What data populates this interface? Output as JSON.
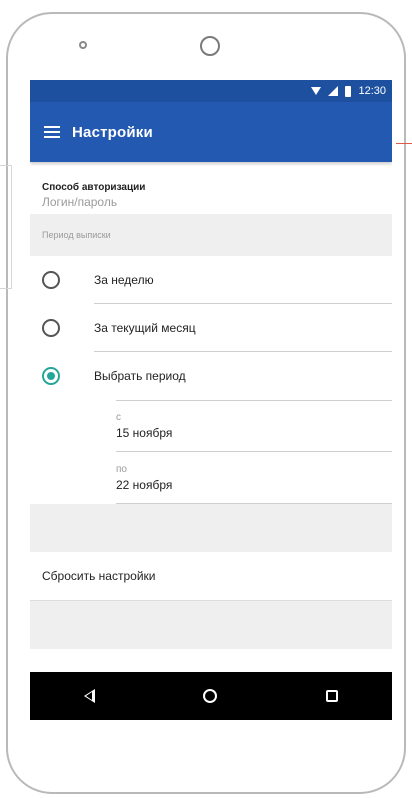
{
  "status_bar": {
    "time": "12:30",
    "icons": [
      "wifi-icon",
      "signal-icon",
      "battery-icon"
    ]
  },
  "app_bar": {
    "title": "Настройки",
    "menu_icon": "hamburger-menu-icon"
  },
  "auth": {
    "label": "Способ авторизации",
    "value": "Логин/пароль"
  },
  "statement_period": {
    "header": "Период выписки",
    "options": [
      {
        "label": "За неделю",
        "selected": false
      },
      {
        "label": "За текущий месяц",
        "selected": false
      },
      {
        "label": "Выбрать период",
        "selected": true
      }
    ],
    "from": {
      "label": "с",
      "date": "15 ноября"
    },
    "to": {
      "label": "по",
      "date": "22 ноября"
    }
  },
  "reset": {
    "label": "Сбросить настройки"
  },
  "nav_bar": {
    "icons": [
      "back-icon",
      "home-icon",
      "recent-apps-icon"
    ]
  },
  "colors": {
    "app_bar": "#2359b0",
    "status_bar": "#1e50a0",
    "accent": "#26a69a"
  }
}
